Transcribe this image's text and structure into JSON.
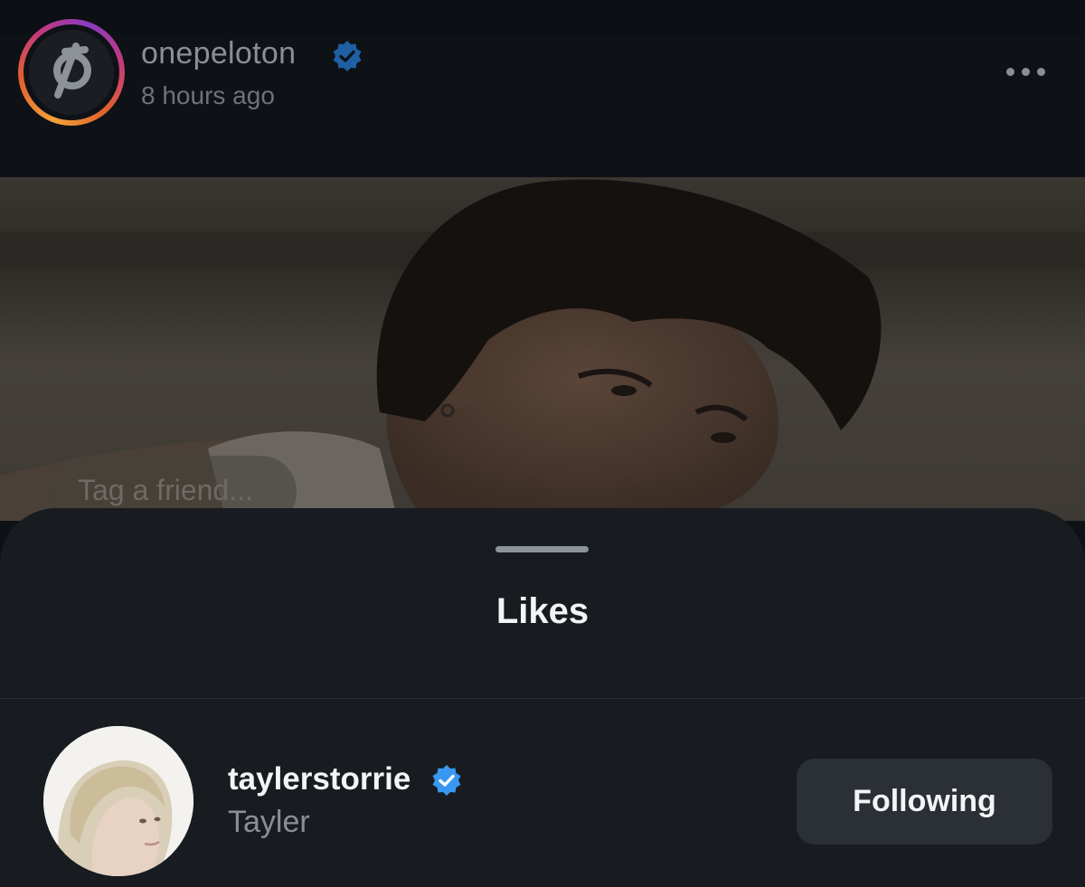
{
  "post": {
    "username": "onepeloton",
    "time": "8 hours ago",
    "tag_placeholder": "Tag a friend..."
  },
  "likes_sheet": {
    "title": "Likes",
    "users": [
      {
        "username": "taylerstorrie",
        "display_name": "Tayler",
        "button_label": "Following"
      }
    ]
  },
  "colors": {
    "verified": "#3897f0",
    "background": "#0e1115",
    "sheet": "#181c20",
    "button": "#2b2f36"
  },
  "icons": {
    "verified": "verified-badge-icon",
    "more": "more-options-icon",
    "brand_logo": "peloton-logo-icon"
  }
}
